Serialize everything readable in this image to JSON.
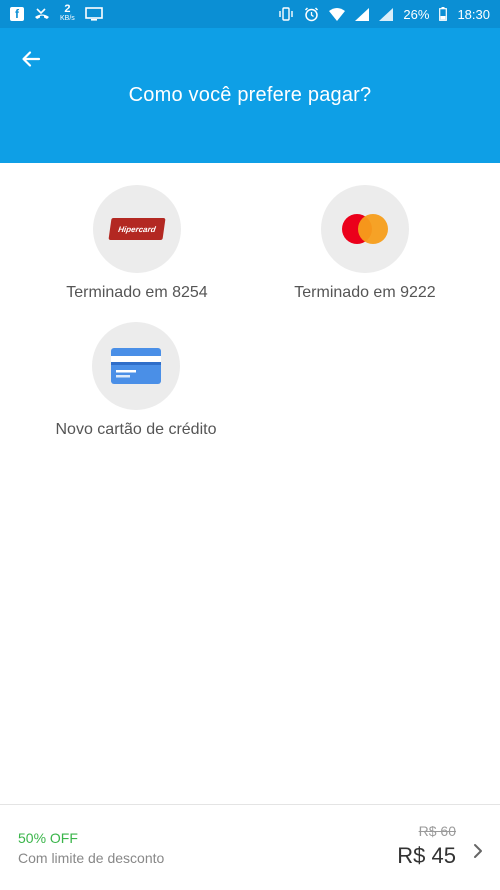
{
  "status_bar": {
    "left_icons": [
      "facebook-icon",
      "missed-call-icon",
      "data-speed-icon",
      "cast-icon"
    ],
    "data_speed_number": "2",
    "data_speed_unit": "KB/s",
    "facebook_letter": "f",
    "right_icons": [
      "vibrate-icon",
      "alarm-icon",
      "wifi-icon",
      "signal-icon",
      "signal-icon",
      "battery-icon"
    ],
    "battery": "26%",
    "time": "18:30"
  },
  "header": {
    "back_icon": "arrow-left-icon",
    "title": "Como você prefere pagar?"
  },
  "payment_options": [
    {
      "brand": "Hipercard",
      "label": "Terminado em 8254",
      "icon": "hipercard-logo"
    },
    {
      "brand": "Mastercard",
      "label": "Terminado em 9222",
      "icon": "mastercard-logo"
    },
    {
      "label": "Novo cartão de crédito",
      "icon": "credit-card-icon"
    }
  ],
  "footer": {
    "discount": "50% OFF",
    "discount_note": "Com limite de desconto",
    "old_price": "R$ 60",
    "new_price": "R$ 45",
    "chevron_icon": "chevron-right-icon"
  },
  "colors": {
    "status_bar": "#0b8fd4",
    "header": "#0e9fe6",
    "discount_green": "#3ab54a",
    "circle_bg": "#ececec"
  }
}
